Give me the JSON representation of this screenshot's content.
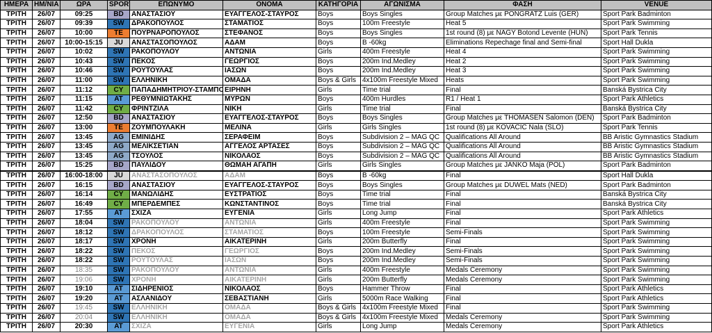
{
  "colors": {
    "header_bg": "#c0c0c0",
    "BD": "#a6a6c8",
    "SW": "#2f75b5",
    "TE": "#ed7d31",
    "JU": "#d9d9d9",
    "CY": "#70ad47",
    "AT": "#5b9bd5",
    "AG": "#8ea9c8",
    "grey_text": "#a6a6a6"
  },
  "headers": [
    "ΗΜΕΡΑ",
    "ΗΜ/ΝΙΑ",
    "ΩΡΑ",
    "SPORT",
    "ΕΠΩΝΥΜΟ",
    "ΟΝΟΜΑ",
    "ΚΑΤΗΓΟΡΙΑ",
    "ΑΓΩΝΙΣΜΑ",
    "ΦΑΣΗ",
    "VENUE"
  ],
  "rows": [
    {
      "day": "ΤΡΙΤΗ",
      "date": "26/07",
      "time": "09:25",
      "sport": "BD",
      "surname": "ΑΝΑΣΤΑΣΙΟΥ",
      "name": "ΕΥΑΓΓΕΛΟΣ-ΣΤΑΥΡΟΣ",
      "category": "Boys",
      "event": "Boys Singles",
      "phase": "Group Matches με PONGRATZ Luis (GER)",
      "venue": "Sport Park Badminton",
      "grey": false,
      "greytime": false
    },
    {
      "day": "ΤΡΙΤΗ",
      "date": "26/07",
      "time": "09:39",
      "sport": "SW",
      "surname": "ΔΡΑΚΟΠΟΥΛΟΣ",
      "name": "ΣΤΑΜΑΤΙΟΣ",
      "category": "Boys",
      "event": "100m Freestyle",
      "phase": "Heat 5",
      "venue": "Sport Park Swimming",
      "grey": false,
      "greytime": false
    },
    {
      "day": "ΤΡΙΤΗ",
      "date": "26/07",
      "time": "10:00",
      "sport": "TE",
      "surname": "ΠΟΥΡΝΑΡΟΠΟΥΛΟΣ",
      "name": "ΣΤΕΦΑΝΟΣ",
      "category": "Boys",
      "event": "Boys Singles",
      "phase": "1st round (8) με NAGY Botond Levente (HUN)",
      "venue": "Sport Park Tennis",
      "grey": false,
      "greytime": false
    },
    {
      "day": "ΤΡΙΤΗ",
      "date": "26/07",
      "time": "10:00-15:15",
      "sport": "JU",
      "surname": "ΑΝΑΣΤΑΣΟΠΟΥΛΟΣ",
      "name": "ΑΔΑΜ",
      "category": "Boys",
      "event": "B -60kg",
      "phase": "Eliminations Repechage final and Semi-final",
      "venue": "Sport Hall Dukla",
      "grey": false,
      "greytime": false
    },
    {
      "day": "ΤΡΙΤΗ",
      "date": "26/07",
      "time": "10:02",
      "sport": "SW",
      "surname": "ΡΑΚΟΠΟΥΛΟΥ",
      "name": "ΑΝΤΩΝΙΑ",
      "category": "Girls",
      "event": "400m Freestyle",
      "phase": "Heat 4",
      "venue": "Sport Park Swimming",
      "grey": false,
      "greytime": false
    },
    {
      "day": "ΤΡΙΤΗ",
      "date": "26/07",
      "time": "10:43",
      "sport": "SW",
      "surname": "ΠΕΚΟΣ",
      "name": "ΓΕΩΡΓΙΟΣ",
      "category": "Boys",
      "event": "200m Ind.Medley",
      "phase": "Heat 2",
      "venue": "Sport Park Swimming",
      "grey": false,
      "greytime": false
    },
    {
      "day": "ΤΡΙΤΗ",
      "date": "26/07",
      "time": "10:46",
      "sport": "SW",
      "surname": "ΡΟΥΤΟΥΛΑΣ",
      "name": "ΙΑΣΩΝ",
      "category": "Boys",
      "event": "200m Ind.Medley",
      "phase": "Heat 3",
      "venue": "Sport Park Swimming",
      "grey": false,
      "greytime": false
    },
    {
      "day": "ΤΡΙΤΗ",
      "date": "26/07",
      "time": "11:00",
      "sport": "SW",
      "surname": "ΕΛΛΗΝΙΚΗ",
      "name": "ΟΜΑΔΑ",
      "category": "Boys & Girls",
      "event": "4x100m Freestyle Mixed",
      "phase": "Heats",
      "venue": "Sport Park Swimming",
      "grey": false,
      "greytime": false
    },
    {
      "day": "ΤΡΙΤΗ",
      "date": "26/07",
      "time": "11:12",
      "sport": "CY",
      "surname": "ΠΑΠΑΔΗΜΗΤΡΙΟΥ-ΣΤΑΜΠΟΡΗ",
      "name": "ΕΙΡΗΝΗ",
      "category": "Girls",
      "event": "Time trial",
      "phase": "Final",
      "venue": "Banská Bystrica City",
      "grey": false,
      "greytime": false
    },
    {
      "day": "ΤΡΙΤΗ",
      "date": "26/07",
      "time": "11:15",
      "sport": "AT",
      "surname": "ΡΕΘΥΜΝΙΩΤΑΚΗΣ",
      "name": "ΜΥΡΩΝ",
      "category": "Boys",
      "event": "400m Hurdles",
      "phase": "R1 / Heat 1",
      "venue": "Sport Park Athletics",
      "grey": false,
      "greytime": false
    },
    {
      "day": "ΤΡΙΤΗ",
      "date": "26/07",
      "time": "11:42",
      "sport": "CY",
      "surname": "ΦΡΙΝΤΖΙΛΑ",
      "name": "ΝΙΚΗ",
      "category": "Girls",
      "event": "Time trial",
      "phase": "Final",
      "venue": "Banská Bystrica City",
      "grey": false,
      "greytime": false
    },
    {
      "day": "ΤΡΙΤΗ",
      "date": "26/07",
      "time": "12:50",
      "sport": "BD",
      "surname": "ΑΝΑΣΤΑΣΙΟΥ",
      "name": "ΕΥΑΓΓΕΛΟΣ-ΣΤΑΥΡΟΣ",
      "category": "Boys",
      "event": "Boys Singles",
      "phase": "Group Matches με THOMASEN Salomon (DEN)",
      "venue": "Sport Park Badminton",
      "grey": false,
      "greytime": false
    },
    {
      "day": "ΤΡΙΤΗ",
      "date": "26/07",
      "time": "13:00",
      "sport": "TE",
      "surname": "ΖΟΥΜΠΟΥΛΑΚΗ",
      "name": "ΜΕΛΙΝΑ",
      "category": "Girls",
      "event": "Girls Singles",
      "phase": "1st round (8) με KOVACIC Nala (SLO)",
      "venue": "Sport Park Tennis",
      "grey": false,
      "greytime": false
    },
    {
      "day": "ΤΡΙΤΗ",
      "date": "26/07",
      "time": "13:45",
      "sport": "AG",
      "surname": "ΕΜΙΝΙΔΗΣ",
      "name": "ΣΕΡΑΦΕΙΜ",
      "category": "Boys",
      "event": "Subdivision 2 – MAG QC",
      "phase": "Qualifications All Around",
      "venue": "BB Aristic Gymnastics Stadium",
      "grey": false,
      "greytime": false
    },
    {
      "day": "ΤΡΙΤΗ",
      "date": "26/07",
      "time": "13:45",
      "sport": "AG",
      "surname": "ΜΕΛΙΚΣΕΤΙΑΝ",
      "name": "ΑΓΓΕΛΟΣ ΑΡΤΑΣΕΣ",
      "category": "Boys",
      "event": "Subdivision 2 – MAG QC",
      "phase": "Qualifications All Around",
      "venue": "BB Aristic Gymnastics Stadium",
      "grey": false,
      "greytime": false
    },
    {
      "day": "ΤΡΙΤΗ",
      "date": "26/07",
      "time": "13:45",
      "sport": "AG",
      "surname": "ΤΣΟΥΛΟΣ",
      "name": "ΝΙΚΟΛΑΟΣ",
      "category": "Boys",
      "event": "Subdivision 2 – MAG QC",
      "phase": "Qualifications All Around",
      "venue": "BB Aristic Gymnastics Stadium",
      "grey": false,
      "greytime": false
    },
    {
      "day": "ΤΡΙΤΗ",
      "date": "26/07",
      "time": "15:25",
      "sport": "BD",
      "surname": "ΠΑΥΛΙΔΟΥ",
      "name": "ΘΩΜΑΗ ΑΓΑΠΗ",
      "category": "Girls",
      "event": "Girls Singles",
      "phase": "Group Matches με JANKO Maja (POL)",
      "venue": "Sport Park Badminton",
      "grey": false,
      "greytime": false
    },
    {
      "day": "ΤΡΙΤΗ",
      "date": "26/07",
      "time": "16:00-18:00",
      "sport": "JU",
      "surname": "ΑΝΑΣΤΑΣΟΠΟΥΛΟΣ",
      "name": "ΑΔΑΜ",
      "category": "Boys",
      "event": "B -60kg",
      "phase": "Final",
      "venue": "Sport Hall Dukla",
      "grey": true,
      "greytime": false,
      "thick": true
    },
    {
      "day": "ΤΡΙΤΗ",
      "date": "26/07",
      "time": "16:15",
      "sport": "BD",
      "surname": "ΑΝΑΣΤΑΣΙΟΥ",
      "name": "ΕΥΑΓΓΕΛΟΣ-ΣΤΑΥΡΟΣ",
      "category": "Boys",
      "event": "Boys Singles",
      "phase": "Group Matches με DUWEL Mats (NED)",
      "venue": "Sport Park Badminton",
      "grey": false,
      "greytime": false
    },
    {
      "day": "ΤΡΙΤΗ",
      "date": "26/07",
      "time": "16:14",
      "sport": "CY",
      "surname": "ΜΑΝΩΛΙΔΗΣ",
      "name": "ΕΥΣΤΡΑΤΙΟΣ",
      "category": "Boys",
      "event": "Time trial",
      "phase": "Final",
      "venue": "Banská Bystrica City",
      "grey": false,
      "greytime": false
    },
    {
      "day": "ΤΡΙΤΗ",
      "date": "26/07",
      "time": "16:49",
      "sport": "CY",
      "surname": "ΜΠΕΡΔΕΜΠΕΣ",
      "name": "ΚΩΝΣΤΑΝΤΙΝΟΣ",
      "category": "Boys",
      "event": "Time trial",
      "phase": "Final",
      "venue": "Banská Bystrica City",
      "grey": false,
      "greytime": false
    },
    {
      "day": "ΤΡΙΤΗ",
      "date": "26/07",
      "time": "17:55",
      "sport": "AT",
      "surname": "ΣΧΙΖΑ",
      "name": "ΕΥΓΕΝΙΑ",
      "category": "Girls",
      "event": "Long Jump",
      "phase": "Final",
      "venue": "Sport Park Athletics",
      "grey": false,
      "greytime": false
    },
    {
      "day": "ΤΡΙΤΗ",
      "date": "26/07",
      "time": "18:04",
      "sport": "SW",
      "surname": "ΡΑΚΟΠΟΥΛΟΥ",
      "name": "ΑΝΤΩΝΙΑ",
      "category": "Girls",
      "event": "400m Freestyle",
      "phase": "Final",
      "venue": "Sport Park Swimming",
      "grey": true,
      "greytime": false
    },
    {
      "day": "ΤΡΙΤΗ",
      "date": "26/07",
      "time": "18:12",
      "sport": "SW",
      "surname": "ΔΡΑΚΟΠΟΥΛΟΣ",
      "name": "ΣΤΑΜΑΤΙΟΣ",
      "category": "Boys",
      "event": "100m Freestyle",
      "phase": "Semi-Finals",
      "venue": "Sport Park Swimming",
      "grey": true,
      "greytime": false
    },
    {
      "day": "ΤΡΙΤΗ",
      "date": "26/07",
      "time": "18:17",
      "sport": "SW",
      "surname": "ΧΡΟΝΗ",
      "name": "ΑΙΚΑΤΕΡΙΝΗ",
      "category": "Girls",
      "event": "200m Butterfly",
      "phase": "Final",
      "venue": "Sport Park Swimming",
      "grey": false,
      "greytime": false
    },
    {
      "day": "ΤΡΙΤΗ",
      "date": "26/07",
      "time": "18:22",
      "sport": "SW",
      "surname": "ΠΕΚΟΣ",
      "name": "ΓΕΩΡΓΙΟΣ",
      "category": "Boys",
      "event": "200m Ind.Medley",
      "phase": "Semi-Finals",
      "venue": "Sport Park Swimming",
      "grey": true,
      "greytime": false
    },
    {
      "day": "ΤΡΙΤΗ",
      "date": "26/07",
      "time": "18:22",
      "sport": "SW",
      "surname": "ΡΟΥΤΟΥΛΑΣ",
      "name": "ΙΑΣΩΝ",
      "category": "Boys",
      "event": "200m Ind.Medley",
      "phase": "Semi-Finals",
      "venue": "Sport Park Swimming",
      "grey": true,
      "greytime": false
    },
    {
      "day": "ΤΡΙΤΗ",
      "date": "26/07",
      "time": "18:35",
      "sport": "SW",
      "surname": "ΡΑΚΟΠΟΥΛΟΥ",
      "name": "ΑΝΤΩΝΙΑ",
      "category": "Girls",
      "event": "400m Freestyle",
      "phase": "Medals Ceremony",
      "venue": "Sport Park Swimming",
      "grey": true,
      "greytime": true
    },
    {
      "day": "ΤΡΙΤΗ",
      "date": "26/07",
      "time": "19:06",
      "sport": "SW",
      "surname": "ΧΡΟΝΗ",
      "name": "ΑΙΚΑΤΕΡΙΝΗ",
      "category": "Girls",
      "event": "200m Butterfly",
      "phase": "Medals Ceremony",
      "venue": "Sport Park Swimming",
      "grey": true,
      "greytime": true
    },
    {
      "day": "ΤΡΙΤΗ",
      "date": "26/07",
      "time": "19:10",
      "sport": "AT",
      "surname": "ΣΙΔΗΡΕΝΙΟΣ",
      "name": "ΝΙΚΟΛΑΟΣ",
      "category": "Boys",
      "event": "Hammer Throw",
      "phase": "Final",
      "venue": "Sport Park Athletics",
      "grey": false,
      "greytime": false
    },
    {
      "day": "ΤΡΙΤΗ",
      "date": "26/07",
      "time": "19:20",
      "sport": "AT",
      "surname": "ΑΣΛΑΝΙΔΟΥ",
      "name": "ΣΕΒΑΣΤΙΑΝΗ",
      "category": "Girls",
      "event": "5000m Race Walking",
      "phase": "Final",
      "venue": "Sport Park Athletics",
      "grey": false,
      "greytime": false
    },
    {
      "day": "ΤΡΙΤΗ",
      "date": "26/07",
      "time": "19:45",
      "sport": "SW",
      "surname": "ΕΛΛΗΝΙΚΗ",
      "name": "ΟΜΑΔΑ",
      "category": "Boys & Girls",
      "event": "4x100m Freestyle Mixed",
      "phase": "Final",
      "venue": "Sport Park Swimming",
      "grey": true,
      "greytime": true
    },
    {
      "day": "ΤΡΙΤΗ",
      "date": "26/07",
      "time": "20:04",
      "sport": "SW",
      "surname": "ΕΛΛΗΝΙΚΗ",
      "name": "ΟΜΑΔΑ",
      "category": "Boys & Girls",
      "event": "4x100m Freestyle Mixed",
      "phase": "Medals Ceremony",
      "venue": "Sport Park Swimming",
      "grey": true,
      "greytime": true
    },
    {
      "day": "ΤΡΙΤΗ",
      "date": "26/07",
      "time": "20:30",
      "sport": "AT",
      "surname": "ΣΧΙΖΑ",
      "name": "ΕΥΓΕΝΙΑ",
      "category": "Girls",
      "event": "Long Jump",
      "phase": "Medals Ceremony",
      "venue": "Sport Park Athletics",
      "grey": true,
      "greytime": false
    }
  ]
}
